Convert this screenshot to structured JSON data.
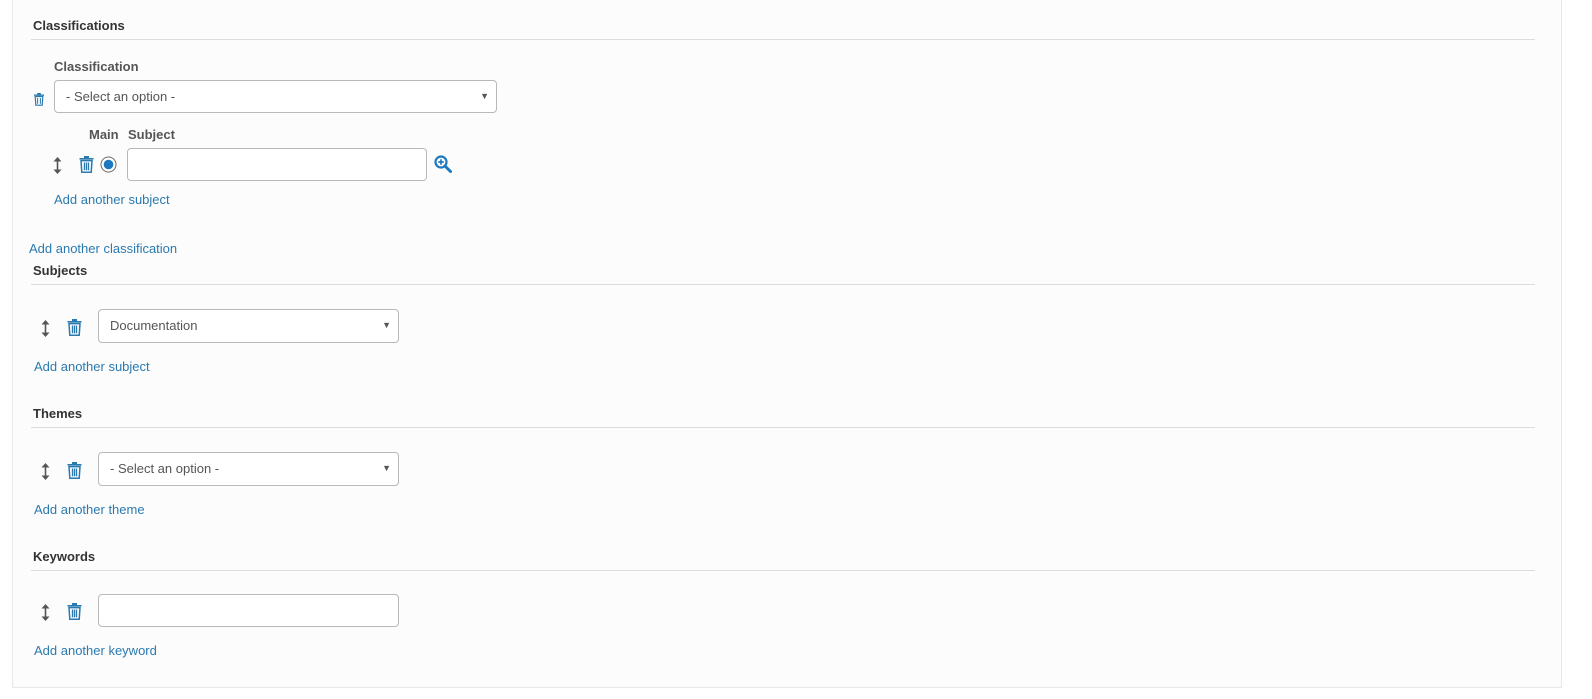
{
  "classifications": {
    "title": "Classifications",
    "classification_label": "Classification",
    "classification_select": {
      "value": "- Select an option -"
    },
    "main_label": "Main",
    "subject_label": "Subject",
    "subject_input": {
      "value": "",
      "placeholder": ""
    },
    "add_subject_link": "Add another subject",
    "add_classification_link": "Add another classification"
  },
  "subjects": {
    "title": "Subjects",
    "select": {
      "value": "Documentation"
    },
    "add_link": "Add another subject"
  },
  "themes": {
    "title": "Themes",
    "select": {
      "value": "- Select an option -"
    },
    "add_link": "Add another theme"
  },
  "keywords": {
    "title": "Keywords",
    "input": {
      "value": "",
      "placeholder": ""
    },
    "add_link": "Add another keyword"
  },
  "icons": {
    "delete": "trash-icon",
    "reorder": "drag-handle-icon",
    "lookup": "zoom-in-icon",
    "dropdown": "caret-down-icon",
    "radio": "radio-selected-icon"
  },
  "colors": {
    "link": "#2a7ab0",
    "icon_blue": "#2a7ab0",
    "handle": "#555555",
    "border": "#b9b9b9",
    "rule": "#dcdcdc"
  }
}
